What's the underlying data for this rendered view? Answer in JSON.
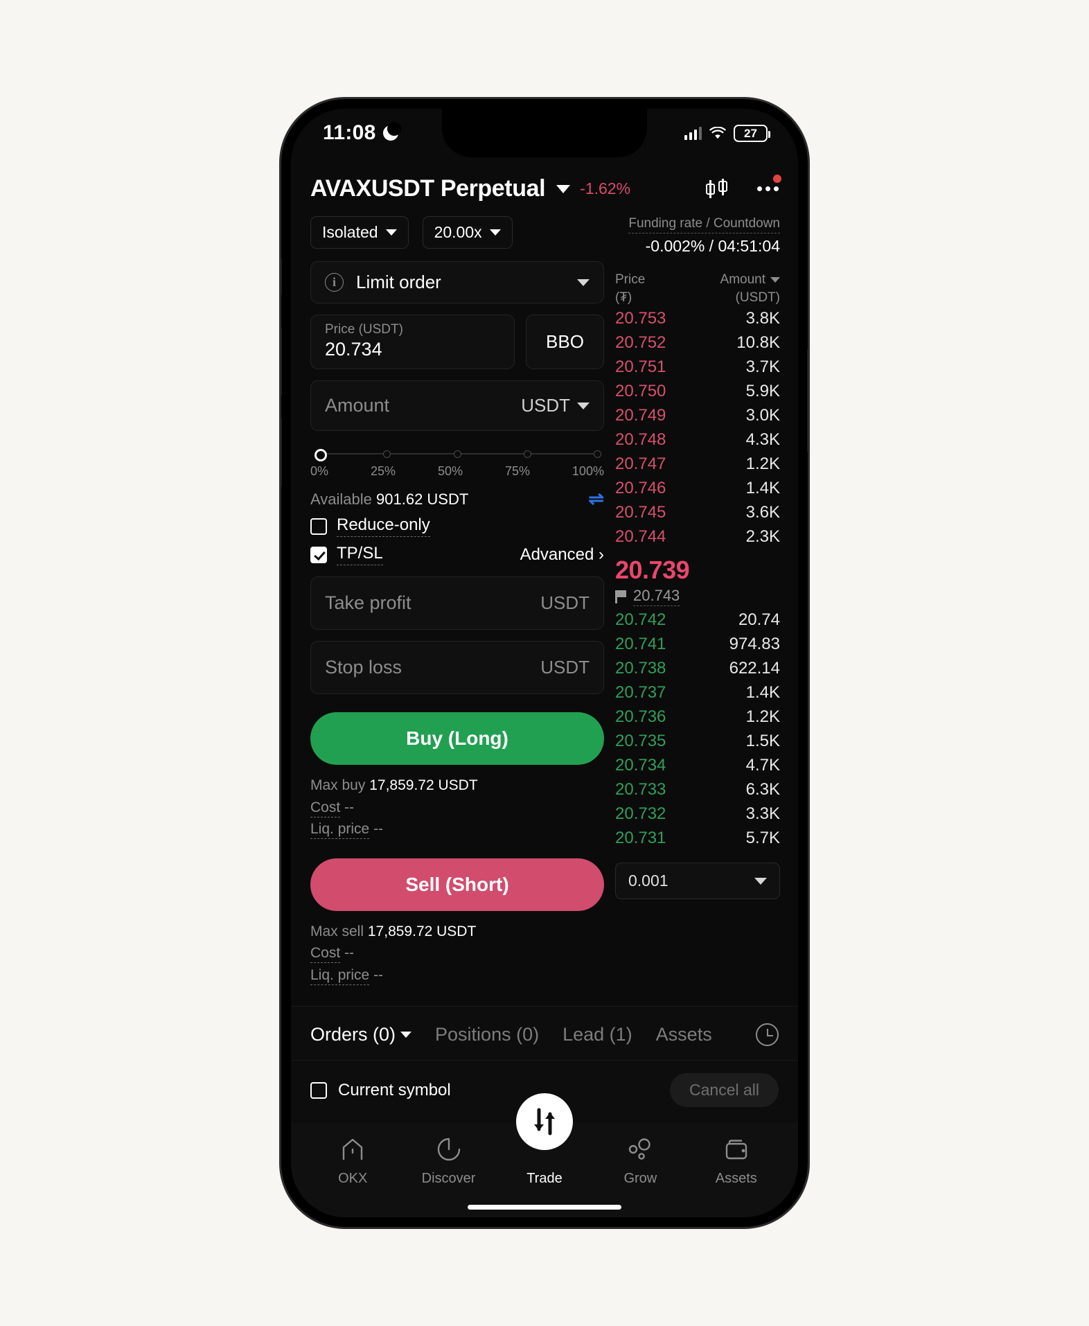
{
  "status_bar": {
    "time": "11:08",
    "moon_icon": "moon-icon",
    "signal_icon": "signal-bars-icon",
    "wifi_icon": "wifi-icon",
    "battery_level": "27"
  },
  "header": {
    "symbol": "AVAXUSDT Perpetual",
    "change_pct": "-1.62%",
    "chart_icon": "candlestick-chart-icon",
    "more_icon": "more-options-icon",
    "accent_down": "#d84a6d"
  },
  "order_form": {
    "margin_mode": "Isolated",
    "leverage": "20.00x",
    "order_type": "Limit order",
    "price_label": "Price (USDT)",
    "price_value": "20.734",
    "bbo_label": "BBO",
    "amount_placeholder": "Amount",
    "amount_unit": "USDT",
    "slider": {
      "value_pct": 0,
      "ticks": [
        "0%",
        "25%",
        "50%",
        "75%",
        "100%"
      ]
    },
    "available_label": "Available",
    "available_value": "901.62 USDT",
    "transfer_icon": "transfer-arrows-icon",
    "reduce_only_label": "Reduce-only",
    "reduce_only_checked": false,
    "tpsl_label": "TP/SL",
    "tpsl_checked": true,
    "advanced_label": "Advanced",
    "take_profit_placeholder": "Take profit",
    "take_profit_unit": "USDT",
    "stop_loss_placeholder": "Stop loss",
    "stop_loss_unit": "USDT",
    "buy": {
      "label": "Buy (Long)",
      "color": "#22a052",
      "max_label": "Max buy",
      "max_value": "17,859.72 USDT",
      "cost_label": "Cost",
      "cost_value": "--",
      "liq_label": "Liq. price",
      "liq_value": "--"
    },
    "sell": {
      "label": "Sell (Short)",
      "color": "#d24c6e",
      "max_label": "Max sell",
      "max_value": "17,859.72 USDT",
      "cost_label": "Cost",
      "cost_value": "--",
      "liq_label": "Liq. price",
      "liq_value": "--"
    }
  },
  "order_book": {
    "funding_label": "Funding rate / Countdown",
    "funding_value": "-0.002% / 04:51:04",
    "col_price": "Price",
    "col_price_unit": "(₮)",
    "col_amount": "Amount",
    "col_amount_unit": "(USDT)",
    "ask_color": "#d6506d",
    "bid_color": "#2f9e5c",
    "asks": [
      {
        "price": "20.753",
        "amount": "3.8K"
      },
      {
        "price": "20.752",
        "amount": "10.8K"
      },
      {
        "price": "20.751",
        "amount": "3.7K"
      },
      {
        "price": "20.750",
        "amount": "5.9K"
      },
      {
        "price": "20.749",
        "amount": "3.0K"
      },
      {
        "price": "20.748",
        "amount": "4.3K"
      },
      {
        "price": "20.747",
        "amount": "1.2K"
      },
      {
        "price": "20.746",
        "amount": "1.4K"
      },
      {
        "price": "20.745",
        "amount": "3.6K"
      },
      {
        "price": "20.744",
        "amount": "2.3K"
      }
    ],
    "last_price": "20.739",
    "mark_price": "20.743",
    "mark_icon": "flag-icon",
    "bids": [
      {
        "price": "20.742",
        "amount": "20.74"
      },
      {
        "price": "20.741",
        "amount": "974.83"
      },
      {
        "price": "20.738",
        "amount": "622.14"
      },
      {
        "price": "20.737",
        "amount": "1.4K"
      },
      {
        "price": "20.736",
        "amount": "1.2K"
      },
      {
        "price": "20.735",
        "amount": "1.5K"
      },
      {
        "price": "20.734",
        "amount": "4.7K"
      },
      {
        "price": "20.733",
        "amount": "6.3K"
      },
      {
        "price": "20.732",
        "amount": "3.3K"
      },
      {
        "price": "20.731",
        "amount": "5.7K"
      }
    ],
    "tick_size": "0.001"
  },
  "bottom_panel": {
    "tabs": [
      {
        "label": "Orders (0)",
        "active": true,
        "has_caret": true
      },
      {
        "label": "Positions (0)",
        "active": false,
        "has_caret": false
      },
      {
        "label": "Lead (1)",
        "active": false,
        "has_caret": false
      },
      {
        "label": "Assets",
        "active": false,
        "has_caret": false
      }
    ],
    "history_icon": "order-history-icon",
    "current_symbol_label": "Current symbol",
    "current_symbol_checked": false,
    "cancel_all_label": "Cancel all"
  },
  "nav": {
    "items": [
      {
        "label": "OKX",
        "icon": "home-icon",
        "active": false
      },
      {
        "label": "Discover",
        "icon": "compass-icon",
        "active": false
      },
      {
        "label": "Trade",
        "icon": "trade-swap-icon",
        "active": true
      },
      {
        "label": "Grow",
        "icon": "grow-bubbles-icon",
        "active": false
      },
      {
        "label": "Assets",
        "icon": "wallet-icon",
        "active": false
      }
    ]
  }
}
